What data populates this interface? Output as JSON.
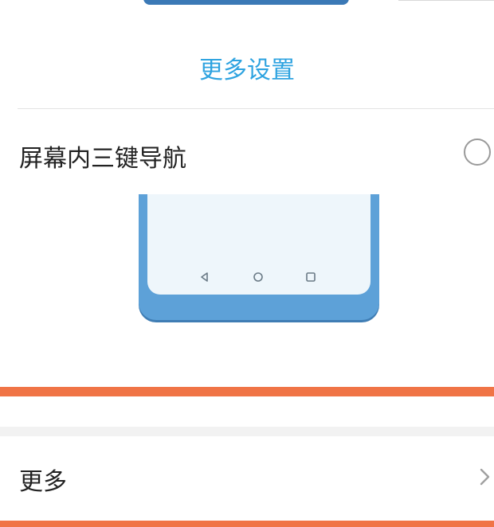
{
  "settings": {
    "more_settings_label": "更多设置",
    "nav_option_label": "屏幕内三键导航",
    "nav_option_selected": false,
    "more_label": "更多"
  },
  "icons": {
    "radio": "radio-unchecked-icon",
    "back": "triangle-back-icon",
    "home": "circle-home-icon",
    "recents": "square-recents-icon",
    "chevron": "chevron-right-icon"
  },
  "colors": {
    "link_blue": "#2ea3e0",
    "phone_blue": "#5da1d8",
    "highlight_orange": "#f07446"
  }
}
